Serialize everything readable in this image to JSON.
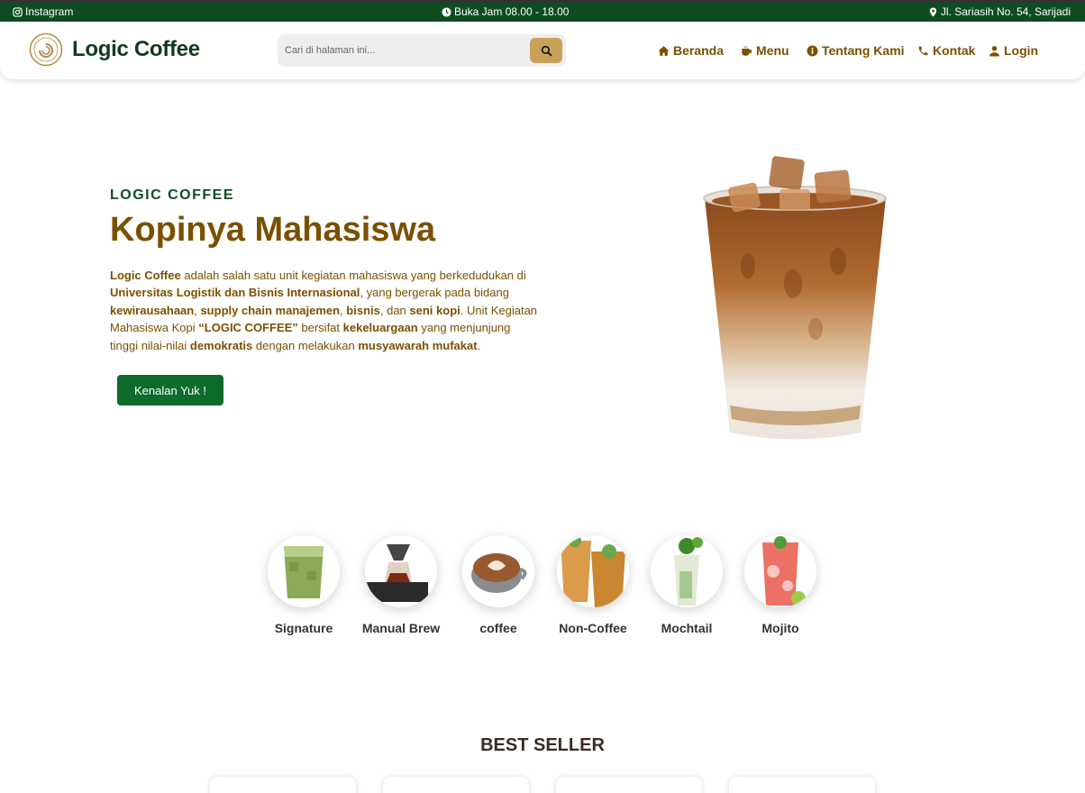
{
  "topbar": {
    "instagram": "Instagram",
    "hours": "Buka Jam 08.00 - 18.00",
    "address": "Jl. Sariasih No. 54, Sarijadi"
  },
  "header": {
    "brand": "Logic Coffee",
    "search_placeholder": "Cari di halaman ini...",
    "nav": {
      "home": "Beranda",
      "menu": "Menu",
      "about": "Tentang Kami",
      "contact": "Kontak",
      "login": "Login"
    }
  },
  "hero": {
    "subtitle": "LOGIC COFFEE",
    "title": "Kopinya Mahasiswa",
    "desc": {
      "p1": "Logic Coffee",
      "p2": " adalah salah satu unit kegiatan mahasiswa yang berkedudukan di ",
      "p3": "Universitas Logistik dan Bisnis Internasional",
      "p4": ", yang bergerak pada bidang ",
      "p5": "kewirausahaan",
      "p6": ", ",
      "p7": "supply chain manajemen",
      "p8": ", ",
      "p9": "bisnis",
      "p10": ", dan ",
      "p11": "seni kopi",
      "p12": ". Unit Kegiatan Mahasiswa Kopi ",
      "p13": "“LOGIC COFFEE”",
      "p14": " bersifat ",
      "p15": "kekeluargaan",
      "p16": " yang menjunjung tinggi nilai-nilai ",
      "p17": "demokratis",
      "p18": " dengan melakukan ",
      "p19": "musyawarah mufakat",
      "p20": "."
    },
    "cta": "Kenalan Yuk !"
  },
  "categories": [
    {
      "label": "Signature"
    },
    {
      "label": "Manual Brew"
    },
    {
      "label": "coffee"
    },
    {
      "label": "Non-Coffee"
    },
    {
      "label": "Mochtail"
    },
    {
      "label": "Mojito"
    }
  ],
  "best_seller": {
    "title": "BEST SELLER"
  },
  "colors": {
    "topbar": "#0d4d20",
    "brand_green": "#0f3b1c",
    "accent_brown": "#7a5000",
    "search_button": "#c9a15a",
    "cta_green": "#0d6b2b"
  }
}
